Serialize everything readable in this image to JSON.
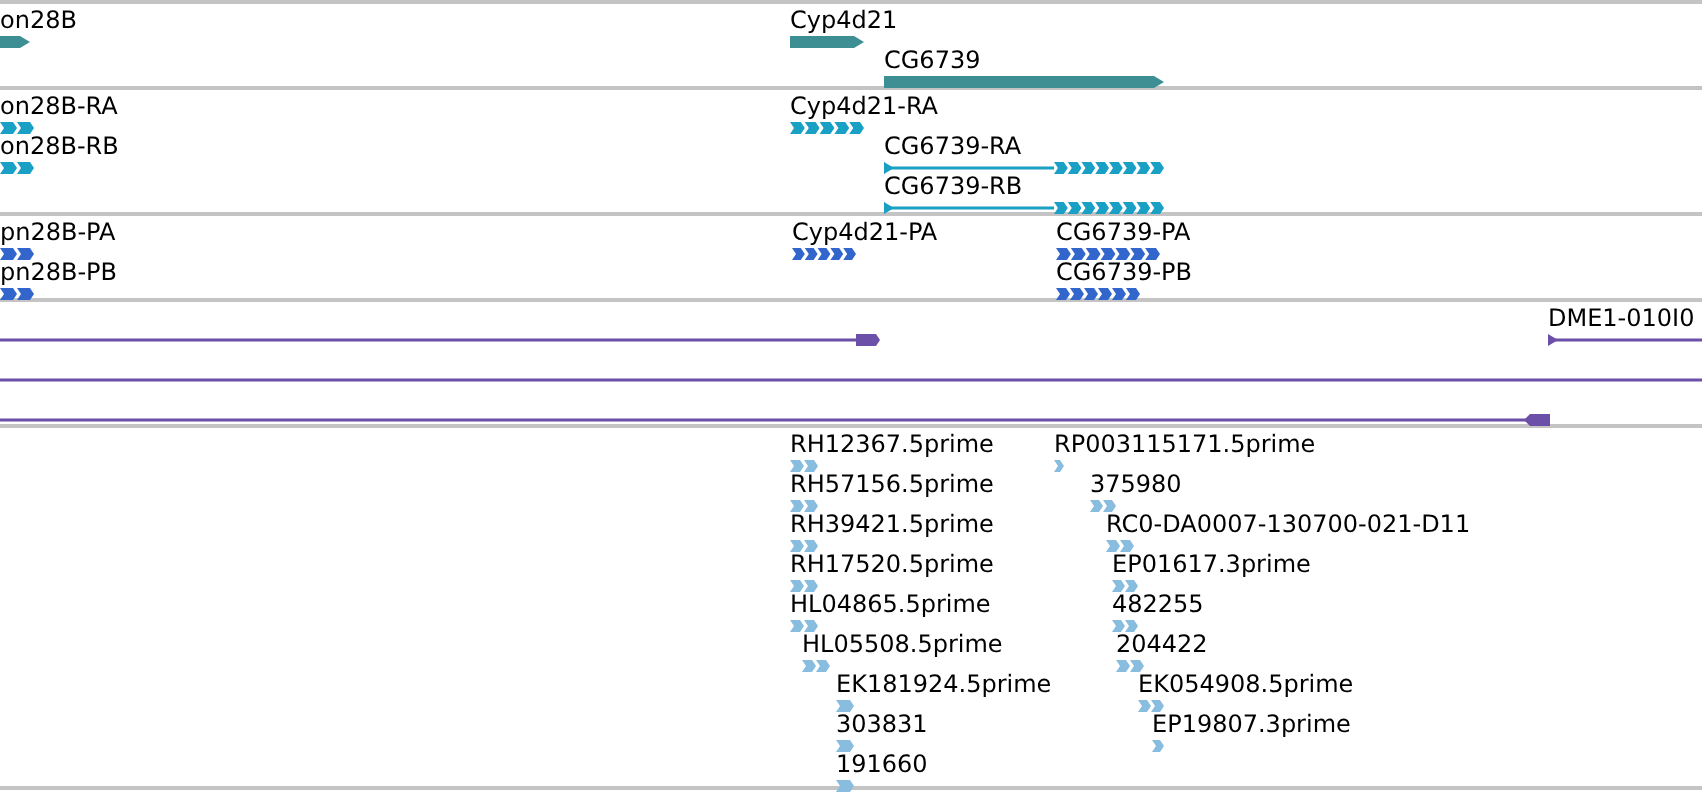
{
  "tracks": [
    {
      "color": "#3d8f94",
      "features": [
        {
          "label": "on28B"
        },
        {
          "label": "Cyp4d21"
        },
        {
          "label": "CG6739"
        }
      ]
    },
    {
      "color": "#1aa0c4",
      "features": [
        {
          "label": "on28B-RA"
        },
        {
          "label": "on28B-RB"
        },
        {
          "label": "Cyp4d21-RA"
        },
        {
          "label": "CG6739-RA"
        },
        {
          "label": "CG6739-RB"
        }
      ]
    },
    {
      "color": "#3366cc",
      "features": [
        {
          "label": "pn28B-PA"
        },
        {
          "label": "pn28B-PB"
        },
        {
          "label": "Cyp4d21-PA"
        },
        {
          "label": "CG6739-PA"
        },
        {
          "label": "CG6739-PB"
        }
      ]
    },
    {
      "color": "#6b4fa8",
      "features": [
        {
          "label": "DME1-010I0"
        }
      ]
    },
    {
      "color": "#88bde0",
      "features": [
        {
          "label": "RH12367.5prime"
        },
        {
          "label": "RH57156.5prime"
        },
        {
          "label": "RH39421.5prime"
        },
        {
          "label": "RH17520.5prime"
        },
        {
          "label": "HL04865.5prime"
        },
        {
          "label": "HL05508.5prime"
        },
        {
          "label": "EK181924.5prime"
        },
        {
          "label": "303831"
        },
        {
          "label": "191660"
        },
        {
          "label": "RP003115171.5prime"
        },
        {
          "label": "375980"
        },
        {
          "label": "RC0-DA0007-130700-021-D11"
        },
        {
          "label": "EP01617.3prime"
        },
        {
          "label": "482255"
        },
        {
          "label": "204422"
        },
        {
          "label": "EK054908.5prime"
        },
        {
          "label": "EP19807.3prime"
        }
      ]
    }
  ]
}
